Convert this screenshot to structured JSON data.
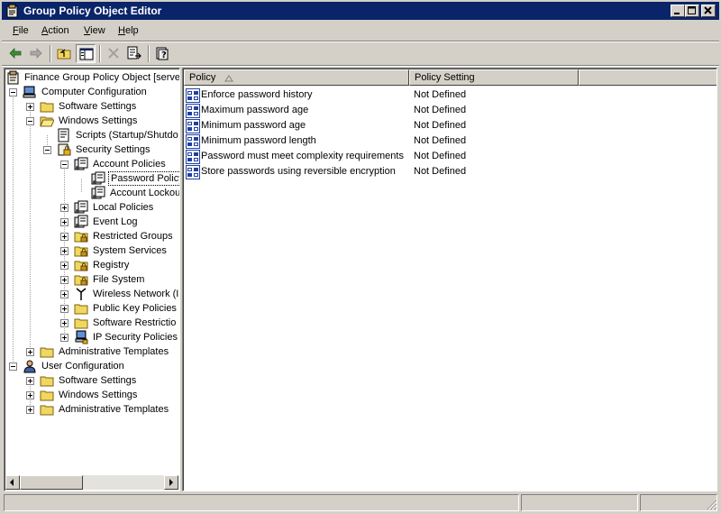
{
  "window": {
    "title": "Group Policy Object Editor"
  },
  "menu": [
    "File",
    "Action",
    "View",
    "Help"
  ],
  "toolbar": {
    "buttons": [
      "back-icon",
      "forward-icon",
      "up-folder-icon",
      "show-hide-tree-icon",
      "delete-icon",
      "export-list-icon",
      "help-icon"
    ]
  },
  "tree": [
    {
      "label": "Finance Group Policy Object [server",
      "icon": "gpo-icon"
    },
    {
      "label": "Computer Configuration",
      "icon": "computer-icon"
    },
    {
      "label": "Software Settings",
      "icon": "folder-icon"
    },
    {
      "label": "Windows Settings",
      "icon": "folder-icon"
    },
    {
      "label": "Scripts (Startup/Shutdo",
      "icon": "script-icon"
    },
    {
      "label": "Security Settings",
      "icon": "security-icon"
    },
    {
      "label": "Account Policies",
      "icon": "policy-icon"
    },
    {
      "label": "Password Policy",
      "icon": "policy-icon"
    },
    {
      "label": "Account Lockou",
      "icon": "policy-icon"
    },
    {
      "label": "Local Policies",
      "icon": "policy-icon"
    },
    {
      "label": "Event Log",
      "icon": "policy-icon"
    },
    {
      "label": "Restricted Groups",
      "icon": "folder-lock-icon"
    },
    {
      "label": "System Services",
      "icon": "folder-lock-icon"
    },
    {
      "label": "Registry",
      "icon": "folder-lock-icon"
    },
    {
      "label": "File System",
      "icon": "folder-lock-icon"
    },
    {
      "label": "Wireless Network (I",
      "icon": "antenna-icon"
    },
    {
      "label": "Public Key Policies",
      "icon": "folder-icon"
    },
    {
      "label": "Software Restrictio",
      "icon": "folder-icon"
    },
    {
      "label": "IP Security Policies c",
      "icon": "ip-security-icon"
    },
    {
      "label": "Administrative Templates",
      "icon": "folder-icon"
    },
    {
      "label": "User Configuration",
      "icon": "user-icon"
    },
    {
      "label": "Software Settings",
      "icon": "folder-icon"
    },
    {
      "label": "Windows Settings",
      "icon": "folder-icon"
    },
    {
      "label": "Administrative Templates",
      "icon": "folder-icon"
    }
  ],
  "list": {
    "columns": [
      "Policy",
      "Policy Setting"
    ],
    "rows": [
      {
        "policy": "Enforce password history",
        "setting": "Not Defined"
      },
      {
        "policy": "Maximum password age",
        "setting": "Not Defined"
      },
      {
        "policy": "Minimum password age",
        "setting": "Not Defined"
      },
      {
        "policy": "Minimum password length",
        "setting": "Not Defined"
      },
      {
        "policy": "Password must meet complexity requirements",
        "setting": "Not Defined"
      },
      {
        "policy": "Store passwords using reversible encryption",
        "setting": "Not Defined"
      }
    ]
  },
  "colors": {
    "titlebar": "#0a246a",
    "face": "#d4d0c8"
  }
}
